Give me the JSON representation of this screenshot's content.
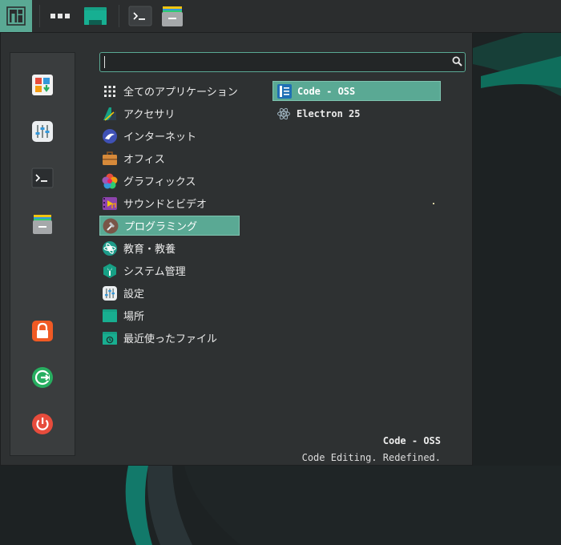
{
  "panel": {
    "items": [
      {
        "name": "manjaro-logo-icon"
      },
      {
        "name": "apps-dots-icon"
      },
      {
        "name": "folder-icon"
      },
      {
        "name": "terminal-icon"
      },
      {
        "name": "drawer-icon"
      }
    ]
  },
  "favorites": [
    {
      "name": "software-center-icon"
    },
    {
      "name": "settings-manager-icon"
    },
    {
      "name": "terminal-icon"
    },
    {
      "name": "file-manager-icon"
    },
    {
      "name": "lock-icon"
    },
    {
      "name": "logout-icon"
    },
    {
      "name": "power-icon"
    }
  ],
  "search": {
    "value": "",
    "placeholder": ""
  },
  "categories": [
    {
      "label": "全てのアプリケーション",
      "icon": "grid-icon"
    },
    {
      "label": "アクセサリ",
      "icon": "accessories-icon"
    },
    {
      "label": "インターネット",
      "icon": "internet-icon"
    },
    {
      "label": "オフィス",
      "icon": "office-icon"
    },
    {
      "label": "グラフィックス",
      "icon": "graphics-icon"
    },
    {
      "label": "サウンドとビデオ",
      "icon": "multimedia-icon"
    },
    {
      "label": "プログラミング",
      "icon": "development-icon",
      "selected": true
    },
    {
      "label": "教育・教養",
      "icon": "education-icon"
    },
    {
      "label": "システム管理",
      "icon": "system-icon"
    },
    {
      "label": "設定",
      "icon": "settings-icon"
    },
    {
      "label": "場所",
      "icon": "places-icon"
    },
    {
      "label": "最近使ったファイル",
      "icon": "recent-icon"
    }
  ],
  "apps": [
    {
      "label": "Code - OSS",
      "icon": "code-oss-icon",
      "selected": true
    },
    {
      "label": "Electron 25",
      "icon": "electron-icon"
    }
  ],
  "description": {
    "title": "Code - OSS",
    "text": "Code Editing. Redefined."
  },
  "colors": {
    "accent": "#5aa994",
    "panel": "#2b2d2e",
    "menu": "#2e3132"
  }
}
